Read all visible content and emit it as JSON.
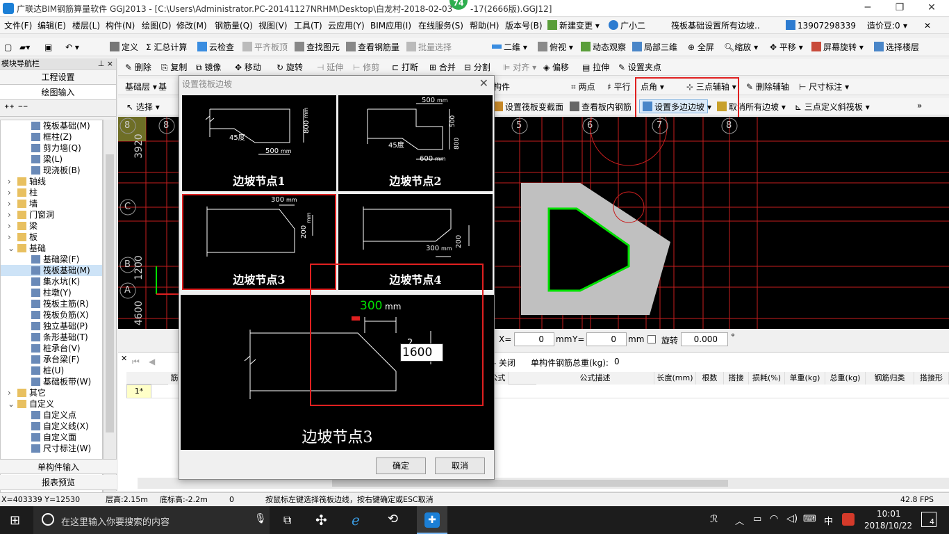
{
  "window": {
    "title": "广联达BIM钢筋算量软件 GGJ2013 - [C:\\Users\\Administrator.PC-20141127NRHM\\Desktop\\白龙村-2018-02-03",
    "title_suffix": "-17(2666版).GGJ12]",
    "badge": "74"
  },
  "menu": [
    "文件(F)",
    "编辑(E)",
    "楼层(L)",
    "构件(N)",
    "绘图(D)",
    "修改(M)",
    "钢筋量(Q)",
    "视图(V)",
    "工具(T)",
    "云应用(Y)",
    "BIM应用(I)",
    "在线服务(S)",
    "帮助(H)",
    "版本号(B)"
  ],
  "menu_right": {
    "new_change": "新建变更",
    "xiaoer": "广小二",
    "hint": "筏板基础设置所有边坡..",
    "phone": "13907298339",
    "cost": "造价豆:0"
  },
  "toolbar1": [
    "定义",
    "汇总计算",
    "云检查",
    "平齐板顶",
    "查找图元",
    "查看钢筋量",
    "批量选择",
    "二维",
    "俯视",
    "动态观察",
    "局部三维",
    "全屏",
    "缩放",
    "平移",
    "屏幕旋转",
    "选择楼层"
  ],
  "toolbar2": [
    "删除",
    "复制",
    "镜像",
    "移动",
    "旋转",
    "延伸",
    "修剪",
    "打断",
    "合并",
    "分割",
    "对齐",
    "偏移",
    "拉伸",
    "设置夹点"
  ],
  "toolbar3": {
    "layer": "基础层",
    "layer2": "基",
    "comp": "构件",
    "two_point": "两点",
    "parallel": "平行",
    "point_angle": "点角",
    "three_point_axis": "三点辅轴",
    "del_axis": "删除辅轴",
    "dim": "尺寸标注"
  },
  "toolbar4": {
    "select": "选择",
    "set_section": "设置筏板变截面",
    "view_rebar": "查看板内钢筋",
    "set_slope": "设置多边边坡",
    "cancel_slope": "取消所有边坡",
    "three_point_slope": "三点定义斜筏板"
  },
  "sidebar": {
    "panel_title": "模块导航栏",
    "pin": "⊥ ×",
    "btn_setup": "工程设置",
    "btn_draw": "绘图输入",
    "btn_single": "单构件输入",
    "btn_report": "报表预览"
  },
  "tree": [
    {
      "label": "筏板基础(M)",
      "indent": 3,
      "icon": "raft-icon"
    },
    {
      "label": "框柱(Z)",
      "indent": 3,
      "icon": "column-icon"
    },
    {
      "label": "剪力墙(Q)",
      "indent": 3,
      "icon": "wall-icon"
    },
    {
      "label": "梁(L)",
      "indent": 3,
      "icon": "beam-icon"
    },
    {
      "label": "现浇板(B)",
      "indent": 3,
      "icon": "slab-icon"
    },
    {
      "label": "轴线",
      "indent": 1,
      "icon": "folder-icon"
    },
    {
      "label": "柱",
      "indent": 1,
      "icon": "folder-icon"
    },
    {
      "label": "墙",
      "indent": 1,
      "icon": "folder-icon"
    },
    {
      "label": "门窗洞",
      "indent": 1,
      "icon": "folder-icon"
    },
    {
      "label": "梁",
      "indent": 1,
      "icon": "folder-icon"
    },
    {
      "label": "板",
      "indent": 1,
      "icon": "folder-icon"
    },
    {
      "label": "基础",
      "indent": 1,
      "icon": "folder-open-icon"
    },
    {
      "label": "基础梁(F)",
      "indent": 3,
      "icon": "foundation-beam-icon"
    },
    {
      "label": "筏板基础(M)",
      "indent": 3,
      "icon": "raft-icon",
      "selected": true
    },
    {
      "label": "集水坑(K)",
      "indent": 3,
      "icon": "sump-icon"
    },
    {
      "label": "柱墩(Y)",
      "indent": 3,
      "icon": "pier-icon"
    },
    {
      "label": "筏板主筋(R)",
      "indent": 3,
      "icon": "main-rebar-icon"
    },
    {
      "label": "筏板负筋(X)",
      "indent": 3,
      "icon": "neg-rebar-icon"
    },
    {
      "label": "独立基础(P)",
      "indent": 3,
      "icon": "isolated-footing-icon"
    },
    {
      "label": "条形基础(T)",
      "indent": 3,
      "icon": "strip-footing-icon"
    },
    {
      "label": "桩承台(V)",
      "indent": 3,
      "icon": "pile-cap-icon"
    },
    {
      "label": "承台梁(F)",
      "indent": 3,
      "icon": "cap-beam-icon"
    },
    {
      "label": "桩(U)",
      "indent": 3,
      "icon": "pile-icon"
    },
    {
      "label": "基础板带(W)",
      "indent": 3,
      "icon": "strip-band-icon"
    },
    {
      "label": "其它",
      "indent": 1,
      "icon": "folder-icon"
    },
    {
      "label": "自定义",
      "indent": 1,
      "icon": "folder-open-icon"
    },
    {
      "label": "自定义点",
      "indent": 3,
      "icon": "custom-point-icon"
    },
    {
      "label": "自定义线(X)",
      "indent": 3,
      "icon": "custom-line-icon"
    },
    {
      "label": "自定义面",
      "indent": 3,
      "icon": "custom-face-icon"
    },
    {
      "label": "尺寸标注(W)",
      "indent": 3,
      "icon": "dimension-icon"
    }
  ],
  "dialog": {
    "title": "设置筏板边坡",
    "nodes": [
      {
        "caption": "边坡节点1",
        "angle": "45度",
        "dim_a": "500",
        "dim_b": "800",
        "unit": "mm"
      },
      {
        "caption": "边坡节点2",
        "angle": "45度",
        "dim_a": "500",
        "dim_b": "600",
        "dim_c": "500",
        "dim_d": "800",
        "unit": "mm"
      },
      {
        "caption": "边坡节点3",
        "dim_a": "300",
        "dim_b": "200",
        "unit": "mm"
      },
      {
        "caption": "边坡节点4",
        "dim_a": "300",
        "dim_b": "200",
        "unit": "mm"
      }
    ],
    "preview": {
      "caption": "边坡节点3",
      "dim_top": "300",
      "unit": "mm",
      "edit_value": "1600",
      "side_mark": "2"
    },
    "ok": "确定",
    "cancel": "取消"
  },
  "canvas": {
    "axis_top": [
      "8",
      "5",
      "6",
      "7",
      "8"
    ],
    "axis_left": [
      "C",
      "B",
      "A"
    ],
    "dims_left": [
      "3920",
      "1200",
      "4600"
    ]
  },
  "coords_bar": {
    "x_label": "X=",
    "x": "0",
    "y_label": "Y=",
    "y": "0",
    "unit": "mm",
    "rotate": "旋转",
    "rotate_val": "0.000"
  },
  "table": {
    "close": "关闭",
    "total_label": "单构件钢筋总重(kg):",
    "total": "0",
    "headers": [
      "筋号",
      "公式",
      "公式描述",
      "长度(mm)",
      "根数",
      "搭接",
      "损耗(%)",
      "单重(kg)",
      "总重(kg)",
      "钢筋归类",
      "搭接形"
    ],
    "row1": "1*"
  },
  "status": {
    "xy": "X=403339 Y=12530",
    "floor_h": "层高:2.15m",
    "bottom_h": "底标高:-2.2m",
    "zero": "0",
    "hint": "按鼠标左键选择筏板边线，按右键确定或ESC取消",
    "fps": "42.8 FPS"
  },
  "taskbar": {
    "search": "在这里输入你要搜索的内容",
    "ime": "中",
    "time": "10:01",
    "date": "2018/10/22",
    "notif": "4"
  },
  "colors": {
    "accent": "#1b7fd6",
    "highlight": "#e02020",
    "edge": "#00e000",
    "grid": "#e02020",
    "slab": "#c0c0c0"
  }
}
